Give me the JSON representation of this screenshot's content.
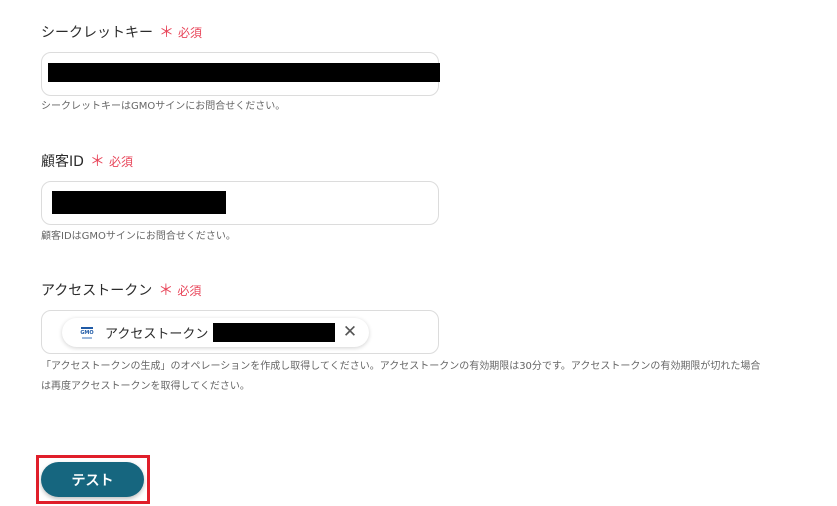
{
  "secret_key": {
    "label": "シークレットキー",
    "required_mark": "＊",
    "required_text": "必須",
    "help": "シークレットキーはGMOサインにお問合せください。"
  },
  "customer_id": {
    "label": "顧客ID",
    "required_mark": "＊",
    "required_text": "必須",
    "help": "顧客IDはGMOサインにお問合せください。"
  },
  "access_token": {
    "label": "アクセストークン",
    "required_mark": "＊",
    "required_text": "必須",
    "chip_logo_text": "GMO",
    "chip_label": "アクセストークン",
    "chip_close": "✕",
    "help_line1": "「アクセストークンの生成」のオペレーションを作成し取得してください。アクセストークンの有効期限は30分です。アクセストークンの有効期限が切れた場合",
    "help_line2": "は再度アクセストークンを取得してください。"
  },
  "test_button": {
    "label": "テスト"
  },
  "colors": {
    "required": "#e8465a",
    "button": "#16667f",
    "highlight": "#e01e2a"
  }
}
